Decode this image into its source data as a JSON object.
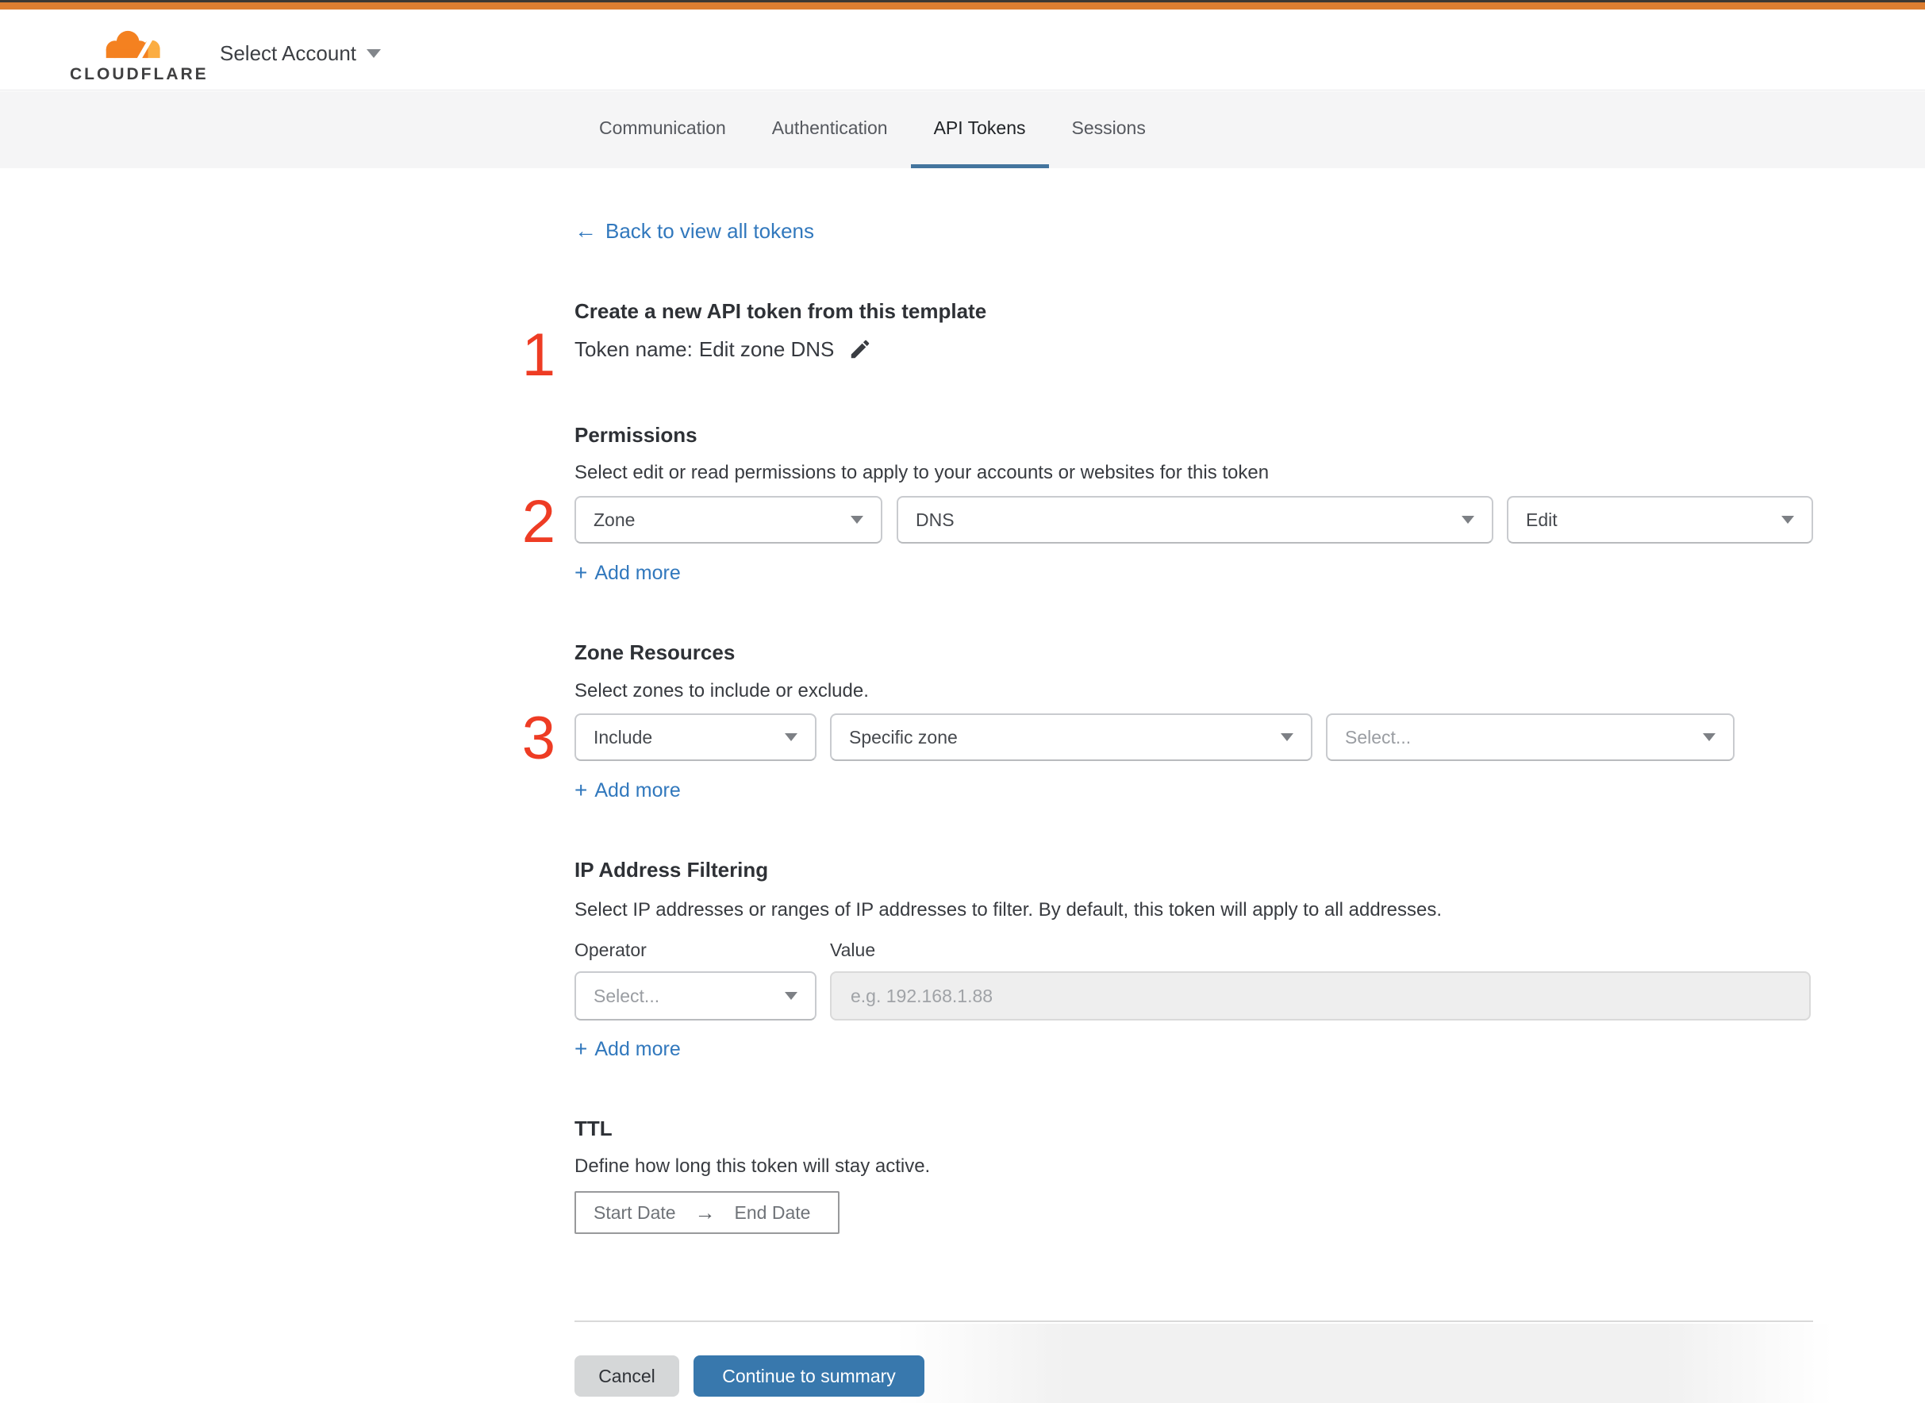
{
  "header": {
    "brand": "CLOUDFLARE",
    "account_selector_label": "Select Account"
  },
  "tabs": [
    {
      "label": "Communication",
      "active": false
    },
    {
      "label": "Authentication",
      "active": false
    },
    {
      "label": "API Tokens",
      "active": true
    },
    {
      "label": "Sessions",
      "active": false
    }
  ],
  "back_link": {
    "icon": "←",
    "label": "Back to view all tokens"
  },
  "token_section": {
    "marker": "1",
    "heading": "Create a new API token from this template",
    "token_name_label": "Token name:",
    "token_name_value": "Edit zone DNS"
  },
  "permissions": {
    "marker": "2",
    "heading": "Permissions",
    "description": "Select edit or read permissions to apply to your accounts or websites for this token",
    "dropdown_scope": "Zone",
    "dropdown_service": "DNS",
    "dropdown_access": "Edit",
    "add_more": {
      "icon": "+",
      "label": "Add more"
    }
  },
  "zone_resources": {
    "marker": "3",
    "heading": "Zone Resources",
    "description": "Select zones to include or exclude.",
    "dropdown_mode": "Include",
    "dropdown_type": "Specific zone",
    "dropdown_zone_placeholder": "Select...",
    "add_more": {
      "icon": "+",
      "label": "Add more"
    }
  },
  "ip_filtering": {
    "heading": "IP Address Filtering",
    "description": "Select IP addresses or ranges of IP addresses to filter. By default, this token will apply to all addresses.",
    "operator_label": "Operator",
    "value_label": "Value",
    "operator_placeholder": "Select...",
    "value_input_placeholder": "e.g. 192.168.1.88",
    "add_more": {
      "icon": "+",
      "label": "Add more"
    }
  },
  "ttl": {
    "heading": "TTL",
    "description": "Define how long this token will stay active.",
    "start_label": "Start Date",
    "arrow": "→",
    "end_label": "End Date"
  },
  "footer": {
    "cancel_label": "Cancel",
    "continue_label": "Continue to summary"
  },
  "colors": {
    "top_bar_orange": "#dd7e31",
    "brand_orange": "#f48120",
    "brand_orange_light": "#fbad41",
    "link_blue": "#3178bd",
    "button_blue": "#3878ad",
    "tab_underline_blue": "#44759e",
    "marker_red": "#ee3c24",
    "tabbar_gray": "#f5f5f6"
  }
}
